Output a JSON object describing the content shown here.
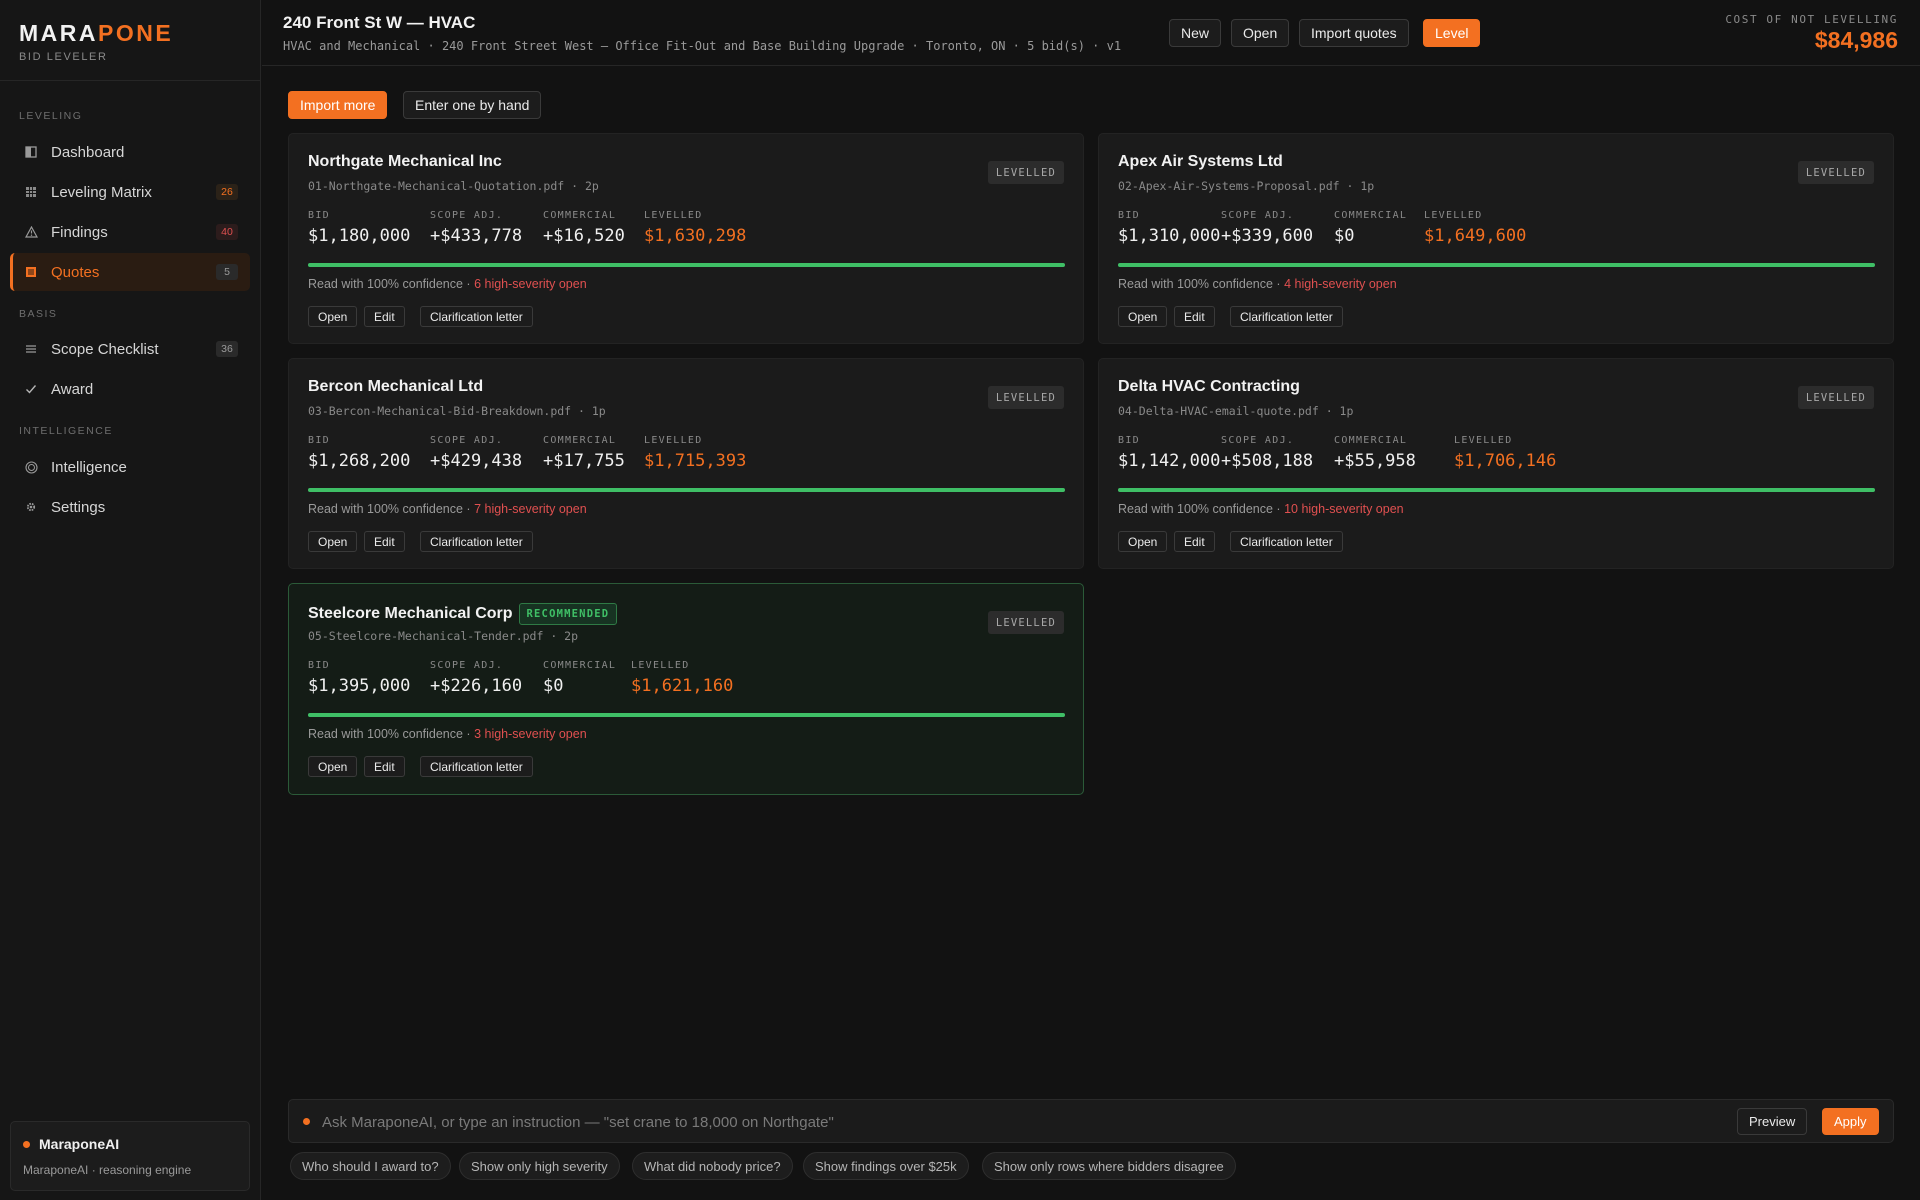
{
  "brand": {
    "name_part1": "MARA",
    "name_part2": "PONE",
    "subtitle": "BID LEVELER"
  },
  "sidebar": {
    "sections": [
      {
        "label": "LEVELING"
      },
      {
        "label": "BASIS"
      },
      {
        "label": "INTELLIGENCE"
      }
    ],
    "items": [
      {
        "label": "Dashboard",
        "icon": "dashboard-icon"
      },
      {
        "label": "Leveling Matrix",
        "icon": "grid-icon",
        "badge": "26"
      },
      {
        "label": "Findings",
        "icon": "warning-icon",
        "badge": "40"
      },
      {
        "label": "Quotes",
        "icon": "document-icon",
        "badge": "5",
        "active": true
      },
      {
        "label": "Scope Checklist",
        "icon": "list-icon",
        "badge": "36"
      },
      {
        "label": "Award",
        "icon": "check-icon"
      },
      {
        "label": "Intelligence",
        "icon": "target-icon"
      },
      {
        "label": "Settings",
        "icon": "gear-icon"
      }
    ],
    "ai": {
      "title": "MaraponeAI",
      "subtitle": "MaraponeAI · reasoning engine"
    }
  },
  "header": {
    "title": "240 Front St W — HVAC",
    "meta": "HVAC and Mechanical · 240 Front Street West — Office Fit-Out and Base Building Upgrade · Toronto, ON · 5 bid(s) · v1",
    "buttons": {
      "new": "New",
      "open": "Open",
      "import": "Import quotes",
      "level": "Level"
    },
    "cost_label": "COST OF NOT LEVELLING",
    "cost_value": "$84,986"
  },
  "actions": {
    "import_more": "Import more",
    "enter_by_hand": "Enter one by hand"
  },
  "labels": {
    "bid": "BID",
    "scope": "SCOPE ADJ.",
    "commercial": "COMMERCIAL",
    "levelled": "LEVELLED",
    "open": "Open",
    "edit": "Edit",
    "clarification": "Clarification letter",
    "recommended": "RECOMMENDED"
  },
  "quotes": [
    {
      "name": "Northgate Mechanical Inc",
      "file": "01-Northgate-Mechanical-Quotation.pdf · 2p",
      "status": "LEVELLED",
      "bid": "$1,180,000",
      "scope": "+$433,778",
      "commercial": "+$16,520",
      "levelled": "$1,630,298",
      "confidence": "Read with 100% confidence · ",
      "severity": "6 high-severity open",
      "confidence_pct": 100
    },
    {
      "name": "Apex Air Systems Ltd",
      "file": "02-Apex-Air-Systems-Proposal.pdf · 1p",
      "status": "LEVELLED",
      "bid": "$1,310,000",
      "scope": "+$339,600",
      "commercial": "$0",
      "levelled": "$1,649,600",
      "confidence": "Read with 100% confidence · ",
      "severity": "4 high-severity open",
      "confidence_pct": 100
    },
    {
      "name": "Bercon Mechanical Ltd",
      "file": "03-Bercon-Mechanical-Bid-Breakdown.pdf · 1p",
      "status": "LEVELLED",
      "bid": "$1,268,200",
      "scope": "+$429,438",
      "commercial": "+$17,755",
      "levelled": "$1,715,393",
      "confidence": "Read with 100% confidence · ",
      "severity": "7 high-severity open",
      "confidence_pct": 100
    },
    {
      "name": "Delta HVAC Contracting",
      "file": "04-Delta-HVAC-email-quote.pdf · 1p",
      "status": "LEVELLED",
      "bid": "$1,142,000",
      "scope": "+$508,188",
      "commercial": "+$55,958",
      "levelled": "$1,706,146",
      "confidence": "Read with 100% confidence · ",
      "severity": "10 high-severity open",
      "confidence_pct": 100
    },
    {
      "name": "Steelcore Mechanical Corp",
      "file": "05-Steelcore-Mechanical-Tender.pdf · 2p",
      "status": "LEVELLED",
      "bid": "$1,395,000",
      "scope": "+$226,160",
      "commercial": "$0",
      "levelled": "$1,621,160",
      "confidence": "Read with 100% confidence · ",
      "severity": "3 high-severity open",
      "confidence_pct": 100,
      "recommended": true
    }
  ],
  "command": {
    "placeholder": "Ask MaraponeAI, or type an instruction — \"set crane to 18,000 on Northgate\"",
    "preview": "Preview",
    "apply": "Apply"
  },
  "suggestions": [
    "Who should I award to?",
    "Show only high severity",
    "What did nobody price?",
    "Show findings over $25k",
    "Show only rows where bidders disagree"
  ],
  "colors": {
    "accent": "#f37021",
    "success": "#3fbf66",
    "danger": "#e05050"
  }
}
